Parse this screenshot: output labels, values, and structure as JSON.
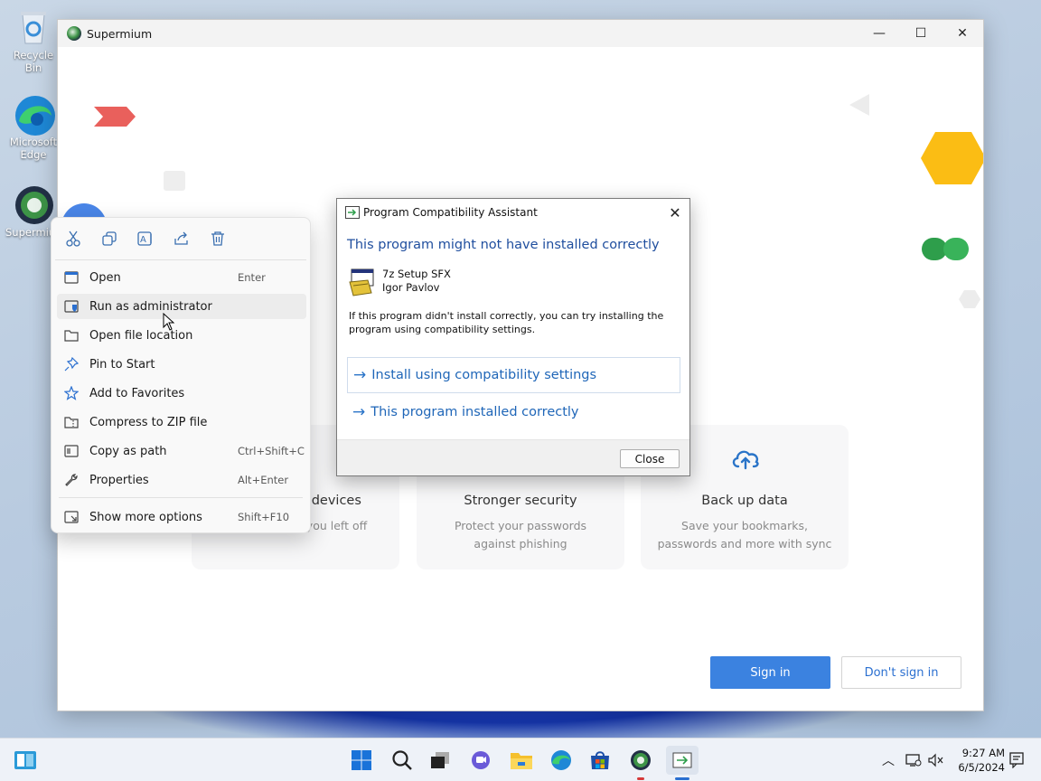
{
  "desktop": {
    "icons": [
      {
        "label": "Recycle Bin"
      },
      {
        "label": "Microsoft Edge"
      },
      {
        "label": "Supermium"
      }
    ]
  },
  "app_window": {
    "title": "Supermium",
    "controls": {
      "minimize": "—",
      "maximize": "☐",
      "close": "✕"
    },
    "cards": [
      {
        "title": "Sync across devices",
        "desc": "Pick up where you left off"
      },
      {
        "title": "Stronger security",
        "desc": "Protect your passwords against phishing"
      },
      {
        "title": "Back up data",
        "desc": "Save your bookmarks, passwords and more with sync"
      }
    ],
    "sign_in_label": "Sign in",
    "dont_sign_in_label": "Don't sign in"
  },
  "context_menu": {
    "toolbar_icons": [
      "cut-icon",
      "copy-icon",
      "rename-icon",
      "share-icon",
      "delete-icon"
    ],
    "items": [
      {
        "label": "Open",
        "shortcut": "Enter",
        "icon": "open-icon"
      },
      {
        "label": "Run as administrator",
        "shortcut": "",
        "icon": "shield-icon"
      },
      {
        "label": "Open file location",
        "shortcut": "",
        "icon": "folder-icon"
      },
      {
        "label": "Pin to Start",
        "shortcut": "",
        "icon": "pin-icon"
      },
      {
        "label": "Add to Favorites",
        "shortcut": "",
        "icon": "star-icon"
      },
      {
        "label": "Compress to ZIP file",
        "shortcut": "",
        "icon": "zip-icon"
      },
      {
        "label": "Copy as path",
        "shortcut": "Ctrl+Shift+C",
        "icon": "copy-path-icon"
      },
      {
        "label": "Properties",
        "shortcut": "Alt+Enter",
        "icon": "wrench-icon"
      },
      {
        "label": "Show more options",
        "shortcut": "Shift+F10",
        "icon": "more-options-icon"
      }
    ]
  },
  "dialog": {
    "title": "Program Compatibility Assistant",
    "heading": "This program might not have installed correctly",
    "program_name": "7z Setup SFX",
    "publisher": "Igor Pavlov",
    "body": "If this program didn't install correctly, you can try installing the program using compatibility settings.",
    "option_1": "Install using compatibility settings",
    "option_2": "This program installed correctly",
    "close_label": "Close",
    "close_x": "✕"
  },
  "taskbar": {
    "time": "9:27 AM",
    "date": "6/5/2024"
  },
  "colors": {
    "accent": "#3b82e0",
    "dialog_heading": "#1f4e9e",
    "link_blue": "#1f66b8"
  }
}
